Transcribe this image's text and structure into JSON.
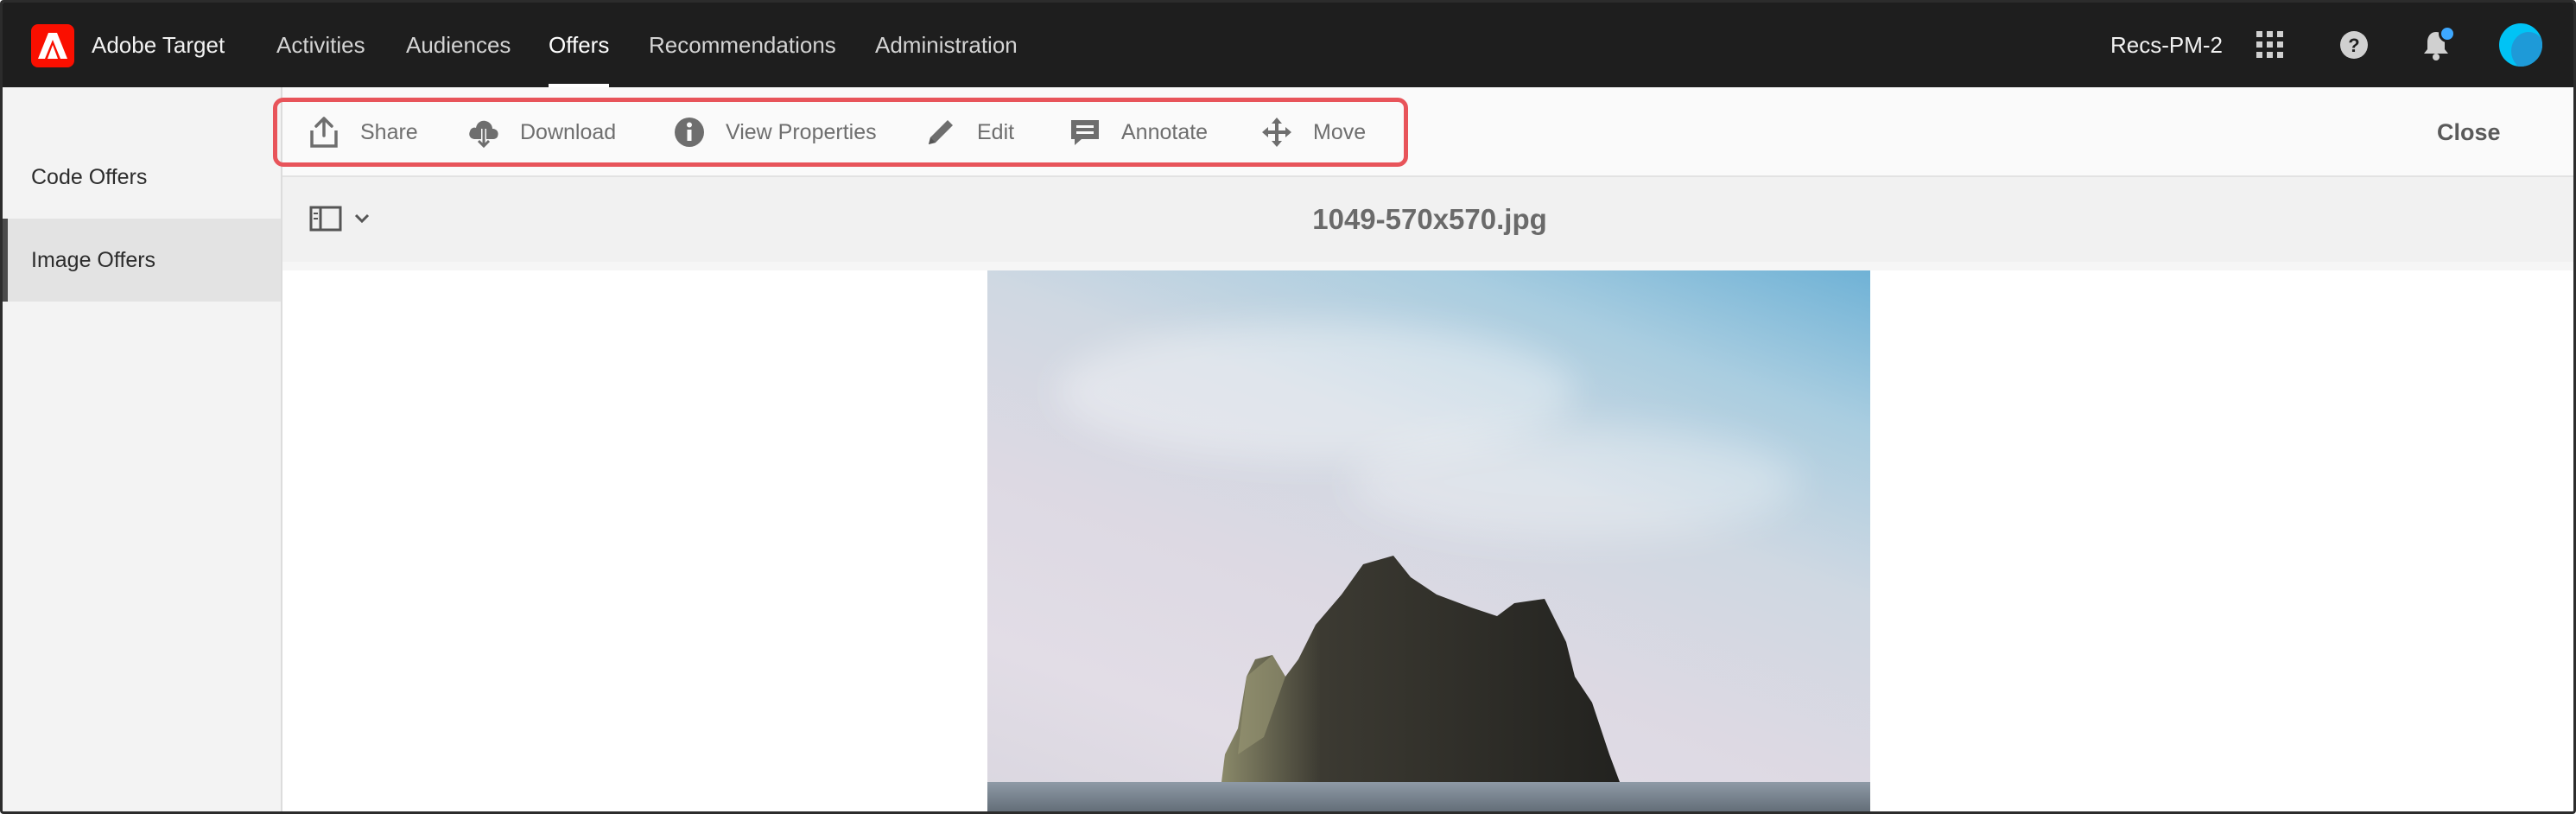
{
  "app": {
    "title": "Adobe Target",
    "logo_icon": "adobe-logo-icon",
    "brand_color": "#fa0f00"
  },
  "topnav": {
    "items": [
      {
        "label": "Activities",
        "active": false
      },
      {
        "label": "Audiences",
        "active": false
      },
      {
        "label": "Offers",
        "active": true
      },
      {
        "label": "Recommendations",
        "active": false
      },
      {
        "label": "Administration",
        "active": false
      }
    ],
    "org_name": "Recs-PM-2",
    "icons": [
      "apps-grid-icon",
      "help-icon",
      "notifications-bell-icon",
      "user-avatar"
    ]
  },
  "sidebar": {
    "items": [
      {
        "label": "Code Offers",
        "selected": false
      },
      {
        "label": "Image Offers",
        "selected": true
      }
    ]
  },
  "actionbar": {
    "actions": [
      {
        "label": "Share",
        "icon": "share-icon"
      },
      {
        "label": "Download",
        "icon": "download-cloud-icon"
      },
      {
        "label": "View Properties",
        "icon": "info-icon"
      },
      {
        "label": "Edit",
        "icon": "pencil-icon"
      },
      {
        "label": "Annotate",
        "icon": "comment-icon"
      },
      {
        "label": "Move",
        "icon": "move-arrows-icon"
      }
    ],
    "close_label": "Close",
    "highlight_color": "#e8545a"
  },
  "viewer": {
    "file_name": "1049-570x570.jpg",
    "panel_toggle_icon": "rail-toggle-icon",
    "preview_alt": "image-preview"
  }
}
